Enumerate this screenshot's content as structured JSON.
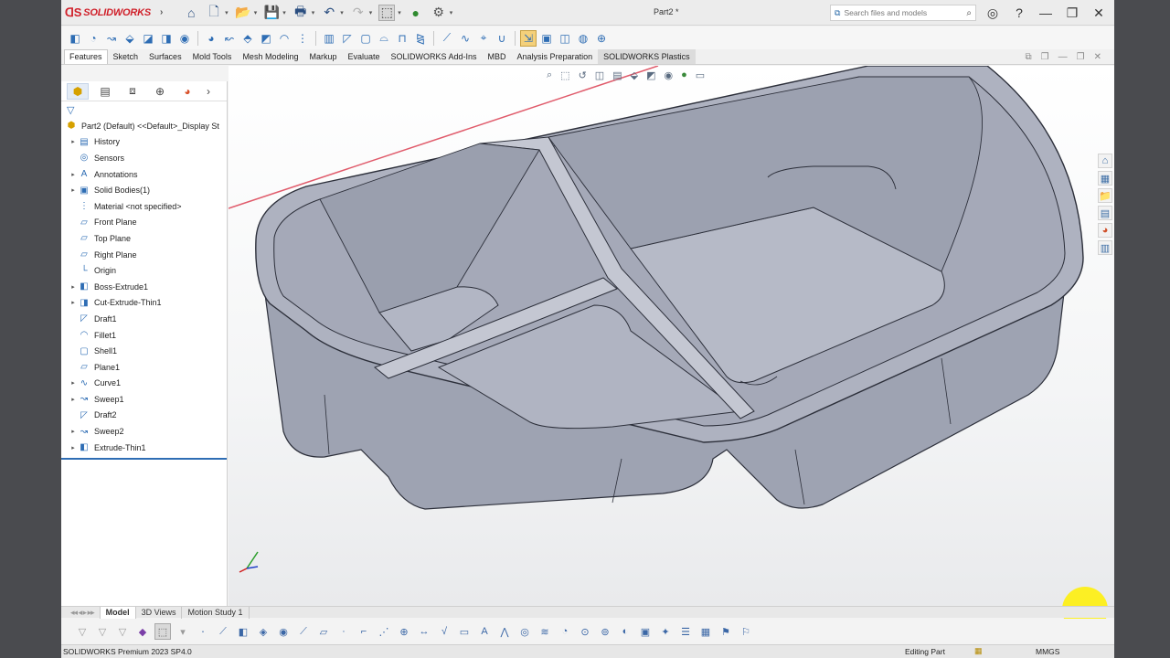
{
  "app": {
    "logo_text": "SOLIDWORKS",
    "document_title": "Part2 *"
  },
  "quick_access_icons": [
    "home-icon",
    "new-document-icon",
    "open-icon",
    "save-icon",
    "print-icon",
    "undo-icon",
    "redo-icon",
    "select-icon",
    "rebuild-icon",
    "options-icon"
  ],
  "search": {
    "placeholder": "Search files and models"
  },
  "title_controls": [
    "user-icon",
    "help-icon",
    "minimize-icon",
    "restore-icon",
    "close-icon"
  ],
  "command_tabs": [
    "Features",
    "Sketch",
    "Surfaces",
    "Mold Tools",
    "Mesh Modeling",
    "Markup",
    "Evaluate",
    "SOLIDWORKS Add-Ins",
    "MBD",
    "Analysis Preparation",
    "SOLIDWORKS Plastics"
  ],
  "active_command_tab": "Features",
  "feature_tree": {
    "root": "Part2 (Default) <<Default>_Display St",
    "items": [
      {
        "label": "History",
        "icon": "history-icon",
        "expandable": true
      },
      {
        "label": "Sensors",
        "icon": "sensor-icon",
        "expandable": false
      },
      {
        "label": "Annotations",
        "icon": "annotation-icon",
        "expandable": true
      },
      {
        "label": "Solid Bodies(1)",
        "icon": "solid-body-icon",
        "expandable": true
      },
      {
        "label": "Material <not specified>",
        "icon": "material-icon",
        "expandable": false
      },
      {
        "label": "Front Plane",
        "icon": "plane-icon",
        "expandable": false
      },
      {
        "label": "Top Plane",
        "icon": "plane-icon",
        "expandable": false
      },
      {
        "label": "Right Plane",
        "icon": "plane-icon",
        "expandable": false
      },
      {
        "label": "Origin",
        "icon": "origin-icon",
        "expandable": false
      },
      {
        "label": "Boss-Extrude1",
        "icon": "extrude-icon",
        "expandable": true
      },
      {
        "label": "Cut-Extrude-Thin1",
        "icon": "cut-extrude-icon",
        "expandable": true
      },
      {
        "label": "Draft1",
        "icon": "draft-icon",
        "expandable": false
      },
      {
        "label": "Fillet1",
        "icon": "fillet-icon",
        "expandable": false
      },
      {
        "label": "Shell1",
        "icon": "shell-icon",
        "expandable": false
      },
      {
        "label": "Plane1",
        "icon": "plane-icon",
        "expandable": false
      },
      {
        "label": "Curve1",
        "icon": "curve-icon",
        "expandable": true
      },
      {
        "label": "Sweep1",
        "icon": "sweep-icon",
        "expandable": true
      },
      {
        "label": "Draft2",
        "icon": "draft-icon",
        "expandable": false
      },
      {
        "label": "Sweep2",
        "icon": "sweep-icon",
        "expandable": true
      },
      {
        "label": "Extrude-Thin1",
        "icon": "extrude-icon",
        "expandable": true
      }
    ]
  },
  "bottom_tabs": [
    "Model",
    "3D Views",
    "Motion Study 1"
  ],
  "active_bottom_tab": "Model",
  "status_bar": {
    "product": "SOLIDWORKS Premium 2023 SP4.0",
    "mode": "Editing Part",
    "units": "MMGS"
  },
  "colors": {
    "brand": "#d0202a",
    "accent": "#2e6db4",
    "model_fill": "#a8acb8",
    "cursor_highlight": "#fff000"
  }
}
